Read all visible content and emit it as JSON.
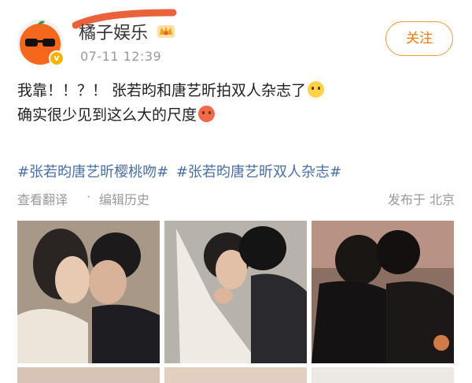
{
  "header": {
    "username": "橘子娱乐",
    "timestamp": "07-11 12:39",
    "follow_label": "关注"
  },
  "post": {
    "line1": "我靠！！？！ 张若昀和唐艺昕拍双人杂志了",
    "line2": "确实很少见到这么大的尺度"
  },
  "hashtags": [
    "#张若昀唐艺昕樱桃吻#",
    "#张若昀唐艺昕双人杂志#"
  ],
  "meta": {
    "translate_label": "查看翻译",
    "separator": "·",
    "edit_history_label": "编辑历史",
    "location": "发布于 北京"
  },
  "icons": {
    "avatar": "orange-sunglasses-avatar",
    "verified": "verified-badge-icon",
    "vip": "crown-badge-icon",
    "emoji1": "crying-face-emoji",
    "emoji2": "hot-face-emoji"
  },
  "colors": {
    "accent": "#f07a0a",
    "hashtag": "#4a6fa5",
    "muted": "#999999",
    "scribble": "#e9623c"
  }
}
